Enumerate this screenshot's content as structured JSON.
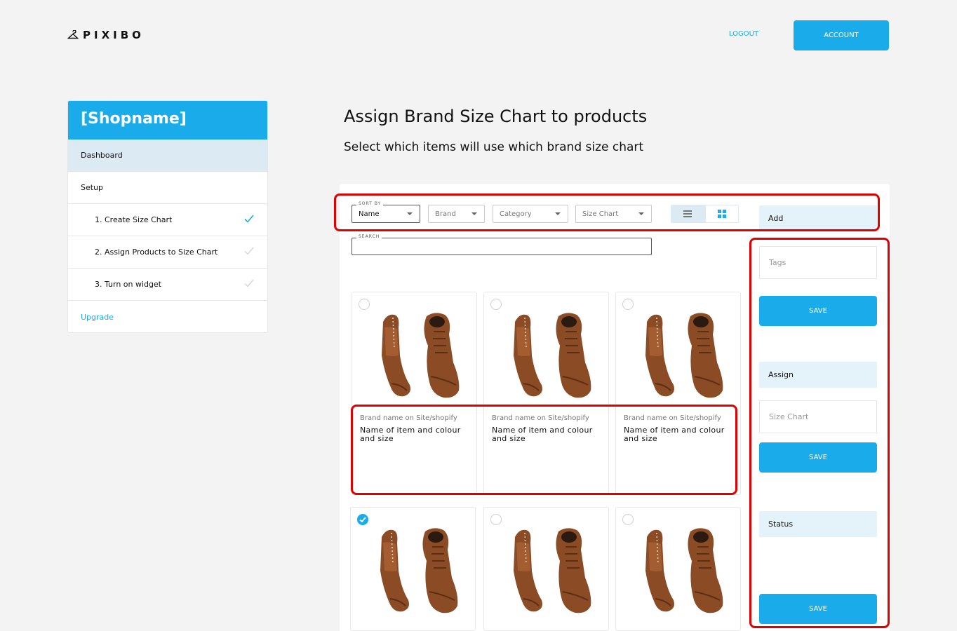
{
  "header": {
    "logo_text": "PIXIBO",
    "logout_label": "LOGOUT",
    "account_label": "ACCOUNT"
  },
  "sidebar": {
    "shop_name": "[Shopname]",
    "items": [
      {
        "label": "Dashboard"
      },
      {
        "label": "Setup"
      },
      {
        "label": "1. Create Size Chart",
        "done": true
      },
      {
        "label": "2. Assign Products to Size Chart",
        "done": false
      },
      {
        "label": "3. Turn on widget",
        "done": false
      },
      {
        "label": "Upgrade"
      }
    ]
  },
  "main": {
    "title": "Assign Brand Size Chart to products",
    "subtitle": "Select which items will use which brand size chart"
  },
  "toolbar": {
    "sort_legend": "SORT BY",
    "sort_value": "Name",
    "brand_placeholder": "Brand",
    "category_placeholder": "Category",
    "size_chart_placeholder": "Size Chart",
    "search_legend": "SEARCH",
    "view_icons": [
      "list-view-icon",
      "grid-view-icon"
    ]
  },
  "right_panel": {
    "add_label": "Add",
    "tags_placeholder": "Tags",
    "save1": "SAVE",
    "assign_label": "Assign",
    "size_chart_placeholder": "Size Chart",
    "save2": "SAVE",
    "status_label": "Status",
    "save3": "SAVE"
  },
  "products": [
    {
      "brand": "Brand name on Site/shopify",
      "name": "Name of item and colour and size",
      "selected": false
    },
    {
      "brand": "Brand name on Site/shopify",
      "name": "Name of item and colour and size",
      "selected": false
    },
    {
      "brand": "Brand name on Site/shopify",
      "name": "Name of item and colour and size",
      "selected": false
    },
    {
      "brand": "",
      "name": "",
      "selected": true
    },
    {
      "brand": "",
      "name": "",
      "selected": false
    },
    {
      "brand": "",
      "name": "",
      "selected": false
    }
  ],
  "colors": {
    "accent": "#1aacea",
    "accent_light": "#e4f3fa",
    "highlight": "#e00000"
  }
}
